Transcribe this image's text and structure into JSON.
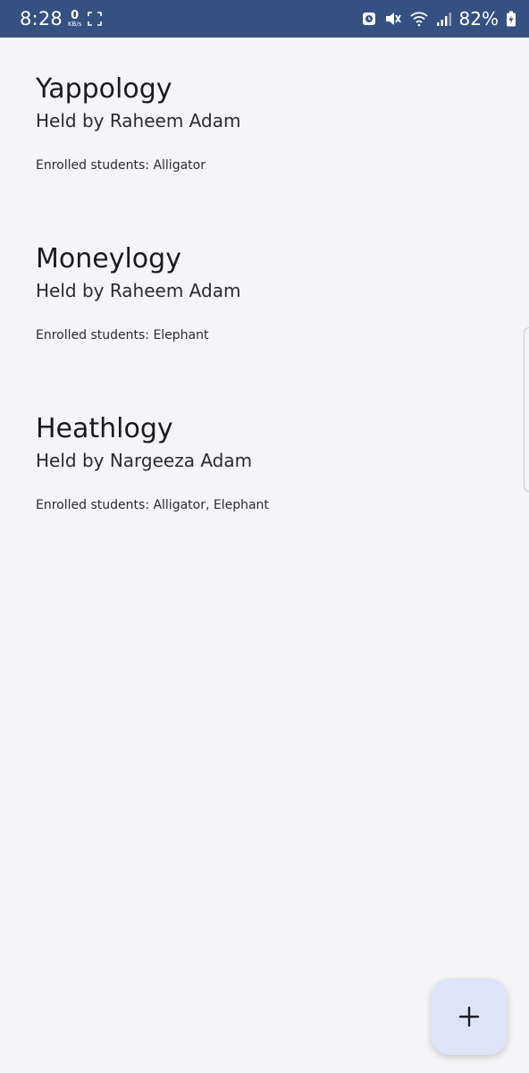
{
  "status_bar": {
    "time": "8:28",
    "net_speed_value": "0",
    "net_speed_unit": "KB/s",
    "battery_percent": "82%",
    "bar_color": "#345182",
    "icons": [
      "screenshot-icon",
      "alarm-icon",
      "mute-icon",
      "wifi-icon",
      "signal-icon",
      "battery-icon"
    ]
  },
  "courses": [
    {
      "title": "Yappology",
      "teacher": "Held by Raheem Adam",
      "students": "Enrolled students: Alligator"
    },
    {
      "title": "Moneylogy",
      "teacher": "Held by Raheem Adam",
      "students": "Enrolled students: Elephant"
    },
    {
      "title": "Heathlogy",
      "teacher": "Held by Nargeeza Adam",
      "students": "Enrolled students: Alligator, Elephant"
    }
  ],
  "fab": {
    "icon": "plus-icon",
    "color": "#dee3f6"
  }
}
